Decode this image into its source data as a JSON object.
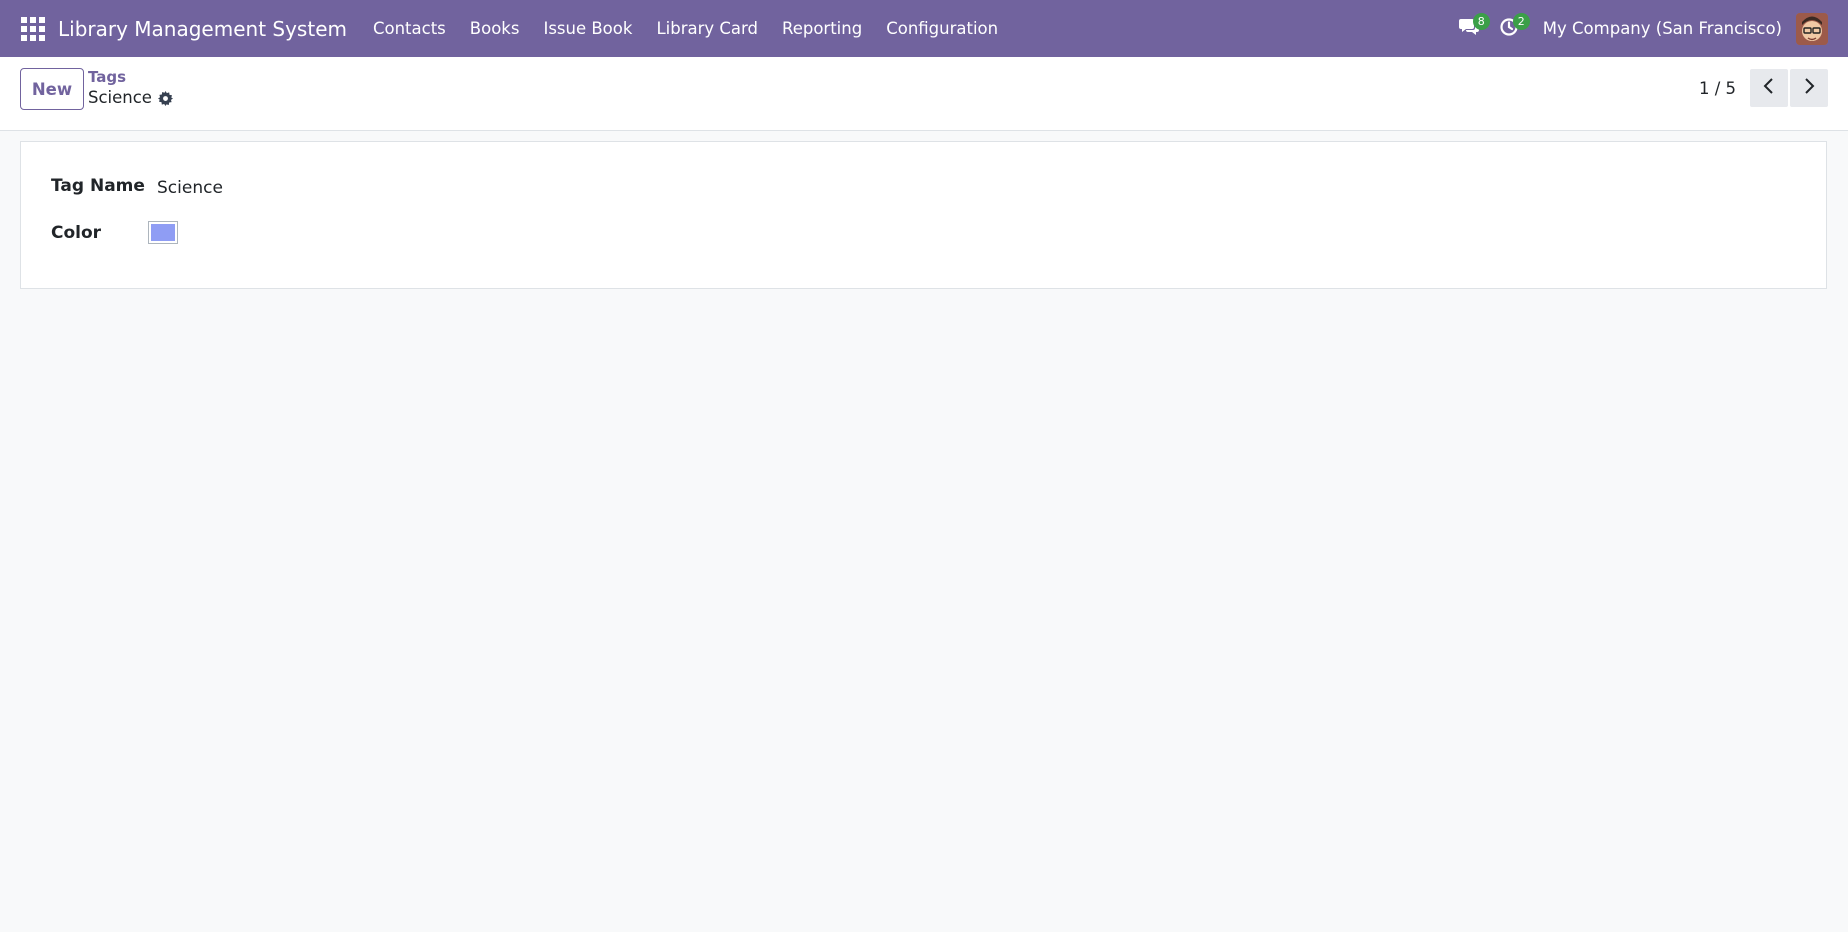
{
  "navbar": {
    "app_title": "Library Management System",
    "menu": [
      "Contacts",
      "Books",
      "Issue Book",
      "Library Card",
      "Reporting",
      "Configuration"
    ],
    "messages_count": "8",
    "activities_count": "2",
    "company": "My Company (San Francisco)",
    "background_color": "#71639e"
  },
  "control_panel": {
    "new_label": "New",
    "breadcrumb_parent": "Tags",
    "breadcrumb_current": "Science",
    "pager_value": "1 / 5"
  },
  "form": {
    "tag_name_label": "Tag Name",
    "tag_name_value": "Science",
    "color_label": "Color",
    "color_value": "#8f9df4"
  }
}
